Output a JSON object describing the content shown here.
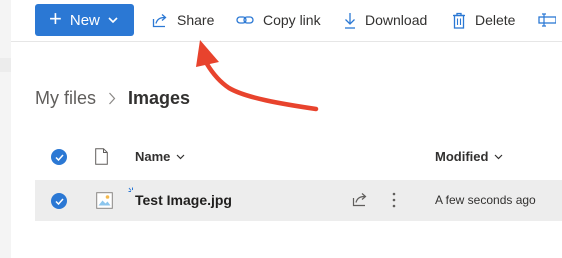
{
  "toolbar": {
    "new_label": "New",
    "share_label": "Share",
    "copy_link_label": "Copy link",
    "download_label": "Download",
    "delete_label": "Delete"
  },
  "breadcrumb": {
    "root": "My files",
    "current": "Images"
  },
  "list": {
    "columns": {
      "name": "Name",
      "modified": "Modified"
    },
    "rows": [
      {
        "name": "Test Image.jpg",
        "modified": "A few seconds ago",
        "selected": true
      }
    ]
  },
  "colors": {
    "accent": "#2b78d4",
    "annotation_arrow": "#e8432d",
    "selected_row": "#ededed"
  },
  "icons": {
    "new": "plus-icon",
    "share": "share-icon",
    "copy_link": "link-icon",
    "download": "download-icon",
    "delete": "trash-icon",
    "file_type": "image-file-icon",
    "row_share": "share-icon",
    "row_more": "more-vertical-icon"
  }
}
